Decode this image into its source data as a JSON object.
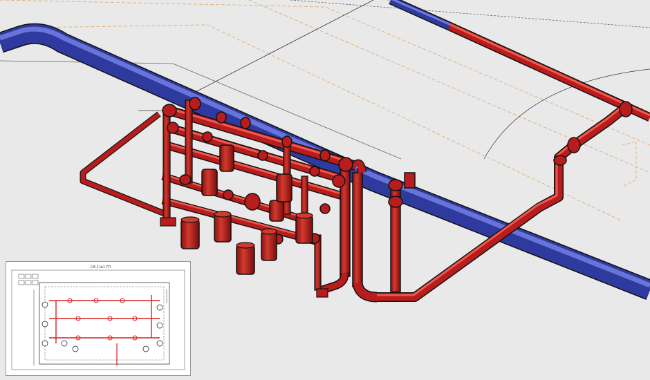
{
  "view": {
    "colors": {
      "background": "#e9e9ea",
      "main_pipe_blue": "#2f3a9e",
      "main_pipe_blue_highlight": "#6f7be0",
      "fire_pipe_red": "#b81c1c",
      "fire_pipe_red_highlight": "#ee5a4d",
      "outline": "#1a1a1a",
      "dashed_boundary": "#e0b27a",
      "guide_line": "#555555"
    }
  },
  "inset": {
    "title_block": "CA-1 №1 ТП"
  }
}
